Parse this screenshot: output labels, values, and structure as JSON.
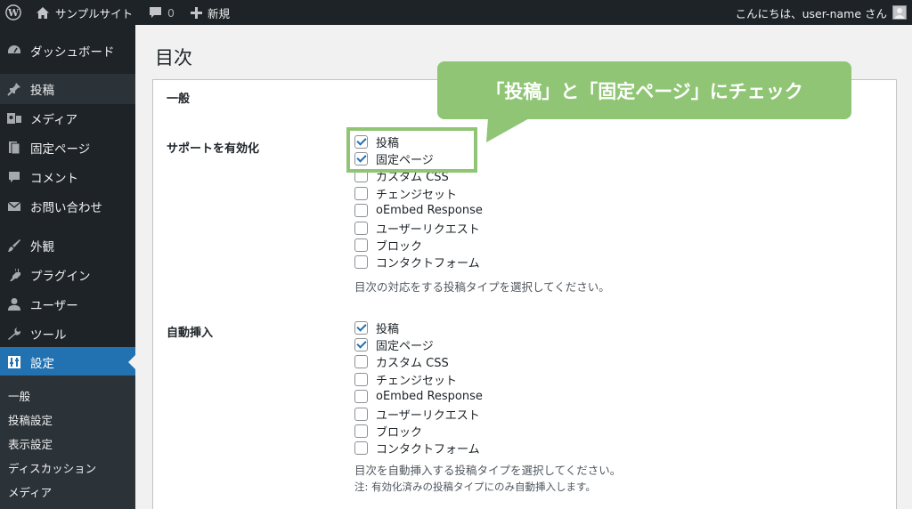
{
  "adminbar": {
    "site_name": "サンプルサイト",
    "comments_count": "0",
    "new_label": "新規",
    "greeting": "こんにちは、user-name さん"
  },
  "sidebar": {
    "items": [
      {
        "label": "ダッシュボード",
        "icon": "dashboard-icon"
      },
      {
        "label": "投稿",
        "icon": "pin-icon"
      },
      {
        "label": "メディア",
        "icon": "media-icon"
      },
      {
        "label": "固定ページ",
        "icon": "page-icon"
      },
      {
        "label": "コメント",
        "icon": "comment-icon"
      },
      {
        "label": "お問い合わせ",
        "icon": "mail-icon"
      },
      {
        "label": "外観",
        "icon": "paintbrush-icon"
      },
      {
        "label": "プラグイン",
        "icon": "plugin-icon"
      },
      {
        "label": "ユーザー",
        "icon": "user-icon"
      },
      {
        "label": "ツール",
        "icon": "wrench-icon"
      },
      {
        "label": "設定",
        "icon": "settings-icon",
        "active": true
      }
    ],
    "submenu": [
      "一般",
      "投稿設定",
      "表示設定",
      "ディスカッション",
      "メディア"
    ]
  },
  "main": {
    "title": "目次",
    "section_general": "一般",
    "support": {
      "label": "サポートを有効化",
      "options": [
        {
          "label": "投稿",
          "checked": true
        },
        {
          "label": "固定ページ",
          "checked": true
        },
        {
          "label": "カスタム CSS",
          "checked": false
        },
        {
          "label": "チェンジセット",
          "checked": false
        },
        {
          "label": "oEmbed Response",
          "checked": false
        },
        {
          "label": "ユーザーリクエスト",
          "checked": false
        },
        {
          "label": "ブロック",
          "checked": false
        },
        {
          "label": "コンタクトフォーム",
          "checked": false
        }
      ],
      "description": "目次の対応をする投稿タイプを選択してください。"
    },
    "auto_insert": {
      "label": "自動挿入",
      "options": [
        {
          "label": "投稿",
          "checked": true
        },
        {
          "label": "固定ページ",
          "checked": true
        },
        {
          "label": "カスタム CSS",
          "checked": false
        },
        {
          "label": "チェンジセット",
          "checked": false
        },
        {
          "label": "oEmbed Response",
          "checked": false
        },
        {
          "label": "ユーザーリクエスト",
          "checked": false
        },
        {
          "label": "ブロック",
          "checked": false
        },
        {
          "label": "コンタクトフォーム",
          "checked": false
        }
      ],
      "description": "目次を自動挿入する投稿タイプを選択してください。",
      "note": "注: 有効化済みの投稿タイプにのみ自動挿入します。"
    }
  },
  "annotation": {
    "callout_text": "「投稿」と「固定ページ」にチェック",
    "color": "#8fc574"
  }
}
